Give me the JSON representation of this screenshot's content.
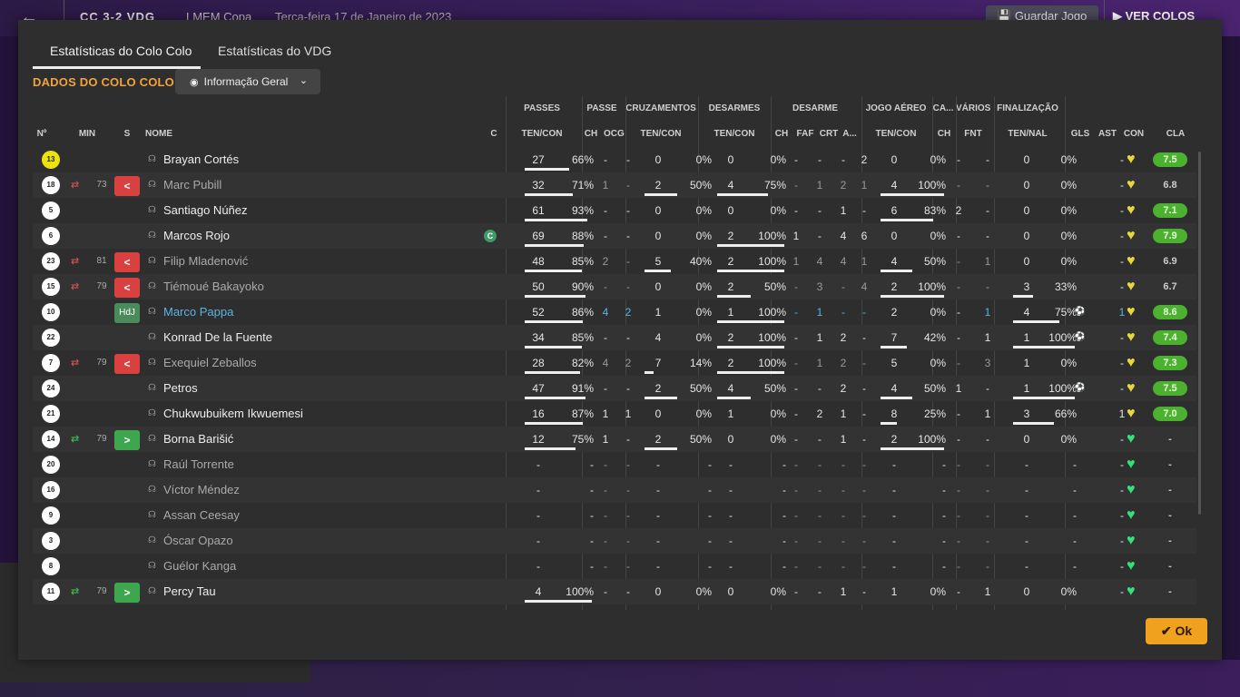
{
  "topbar": {
    "score": "CC 3-2 VDG",
    "competition": "LMEM Copa",
    "date": "Terça-feira 17 de Janeiro de 2023",
    "save_label": "Guardar Jogo",
    "play_label": "VER COLOS"
  },
  "tabs": [
    "Estatísticas do Colo Colo",
    "Estatísticas do VDG"
  ],
  "section_title": "DADOS DO COLO COLO",
  "view_dropdown": "Informação Geral",
  "groups": {
    "passes": "PASSES",
    "passe": "PASSE",
    "cruz": "CRUZAMENTOS",
    "desarmes": "DESARMES",
    "desarme": "DESARME",
    "aereo": "JOGO AÉREO",
    "ca": "CA...",
    "varios": "VÁRIOS",
    "final": "FINALIZAÇÃO"
  },
  "columns": {
    "num": "Nº",
    "min": "MIN",
    "s": "S",
    "name": "NOME",
    "c": "C",
    "passes": "TEN/CON",
    "passe_ch": "CH",
    "passe_ocg": "OCG",
    "cruz": "TEN/CON",
    "desarmes": "TEN/CON",
    "d_ch": "CH",
    "d_faf": "FAF",
    "d_crt": "CRT",
    "d_a": "A...",
    "aereo": "TEN/CON",
    "ca_ch": "CH",
    "fnt": "FNT",
    "final": "TEN/NAL",
    "gls": "GLS",
    "ast": "AST",
    "con": "CON",
    "cla": "CLA"
  },
  "players": [
    {
      "num": "13",
      "gk": true,
      "sub": "",
      "min": "",
      "badge": "",
      "name": "Brayan Cortés",
      "dim": false,
      "blue": false,
      "cap": false,
      "p": [
        "27",
        "66%"
      ],
      "pch": "-",
      "pocg": "-",
      "cr": [
        "0",
        "0%"
      ],
      "ds": [
        "0",
        "0%"
      ],
      "dch": "-",
      "faf": "-",
      "crt": "-",
      "da": "2",
      "ae": [
        "0",
        "0%"
      ],
      "cach": "-",
      "fnt": "-",
      "fi": [
        "0",
        "0%"
      ],
      "gls": "",
      "ast": "-",
      "cla": "7.5",
      "claGreen": true,
      "pf": 0.66,
      "crf": 0,
      "dsf": 0,
      "aef": 0,
      "fif": 0
    },
    {
      "num": "18",
      "gk": false,
      "sub": "out",
      "min": "73",
      "badge": "out",
      "name": "Marc Pubill",
      "dim": true,
      "blue": false,
      "cap": false,
      "p": [
        "32",
        "71%"
      ],
      "pch": "1",
      "pocg": "-",
      "cr": [
        "2",
        "50%"
      ],
      "ds": [
        "4",
        "75%"
      ],
      "dch": "-",
      "faf": "1",
      "crt": "2",
      "da": "1",
      "ae": [
        "4",
        "100%"
      ],
      "cach": "-",
      "fnt": "-",
      "fi": [
        "0",
        "0%"
      ],
      "gls": "",
      "ast": "-",
      "cla": "6.8",
      "claGreen": false,
      "pf": 0.71,
      "crf": 0.5,
      "dsf": 0.75,
      "aef": 1,
      "fif": 0
    },
    {
      "num": "5",
      "gk": false,
      "sub": "",
      "min": "",
      "badge": "",
      "name": "Santiago Núñez",
      "dim": false,
      "blue": false,
      "cap": false,
      "p": [
        "61",
        "93%"
      ],
      "pch": "-",
      "pocg": "-",
      "cr": [
        "0",
        "0%"
      ],
      "ds": [
        "0",
        "0%"
      ],
      "dch": "-",
      "faf": "-",
      "crt": "1",
      "da": "-",
      "ae": [
        "6",
        "83%"
      ],
      "cach": "2",
      "fnt": "-",
      "fi": [
        "0",
        "0%"
      ],
      "gls": "",
      "ast": "-",
      "cla": "7.1",
      "claGreen": true,
      "pf": 0.93,
      "crf": 0,
      "dsf": 0,
      "aef": 0.83,
      "fif": 0
    },
    {
      "num": "6",
      "gk": false,
      "sub": "",
      "min": "",
      "badge": "",
      "name": "Marcos Rojo",
      "dim": false,
      "blue": false,
      "cap": true,
      "p": [
        "69",
        "88%"
      ],
      "pch": "-",
      "pocg": "-",
      "cr": [
        "0",
        "0%"
      ],
      "ds": [
        "2",
        "100%"
      ],
      "dch": "1",
      "faf": "-",
      "crt": "4",
      "da": "6",
      "ae": [
        "0",
        "0%"
      ],
      "cach": "-",
      "fnt": "-",
      "fi": [
        "0",
        "0%"
      ],
      "gls": "",
      "ast": "-",
      "cla": "7.9",
      "claGreen": true,
      "pf": 0.88,
      "crf": 0,
      "dsf": 1,
      "aef": 0,
      "fif": 0
    },
    {
      "num": "23",
      "gk": false,
      "sub": "out",
      "min": "81",
      "badge": "out",
      "name": "Filip Mladenović",
      "dim": true,
      "blue": false,
      "cap": false,
      "p": [
        "48",
        "85%"
      ],
      "pch": "2",
      "pocg": "-",
      "cr": [
        "5",
        "40%"
      ],
      "ds": [
        "2",
        "100%"
      ],
      "dch": "1",
      "faf": "4",
      "crt": "4",
      "da": "1",
      "ae": [
        "4",
        "50%"
      ],
      "cach": "-",
      "fnt": "1",
      "fi": [
        "0",
        "0%"
      ],
      "gls": "",
      "ast": "-",
      "cla": "6.9",
      "claGreen": false,
      "pf": 0.85,
      "crf": 0.4,
      "dsf": 1,
      "aef": 0.5,
      "fif": 0
    },
    {
      "num": "15",
      "gk": false,
      "sub": "out",
      "min": "79",
      "badge": "out",
      "name": "Tiémoué Bakayoko",
      "dim": true,
      "blue": false,
      "cap": false,
      "p": [
        "50",
        "90%"
      ],
      "pch": "-",
      "pocg": "-",
      "cr": [
        "0",
        "0%"
      ],
      "ds": [
        "2",
        "50%"
      ],
      "dch": "-",
      "faf": "3",
      "crt": "-",
      "da": "4",
      "ae": [
        "2",
        "100%"
      ],
      "cach": "-",
      "fnt": "-",
      "fi": [
        "3",
        "33%"
      ],
      "gls": "",
      "ast": "-",
      "cla": "6.7",
      "claGreen": false,
      "pf": 0.9,
      "crf": 0,
      "dsf": 0.5,
      "aef": 1,
      "fif": 0.33
    },
    {
      "num": "10",
      "gk": false,
      "sub": "",
      "min": "",
      "badge": "hdj",
      "name": "Marco Pappa",
      "dim": false,
      "blue": true,
      "cap": false,
      "p": [
        "52",
        "86%"
      ],
      "pch": "4",
      "pocg": "2",
      "cr": [
        "1",
        "0%"
      ],
      "ds": [
        "1",
        "100%"
      ],
      "dch": "-",
      "faf": "1",
      "crt": "-",
      "da": "-",
      "ae": [
        "2",
        "0%"
      ],
      "cach": "-",
      "fnt": "1",
      "fi": [
        "4",
        "75%"
      ],
      "gls": "⚽",
      "ast": "1",
      "cla": "8.6",
      "claGreen": true,
      "pf": 0.86,
      "crf": 0,
      "dsf": 1,
      "aef": 0,
      "fif": 0.75
    },
    {
      "num": "22",
      "gk": false,
      "sub": "",
      "min": "",
      "badge": "",
      "name": "Konrad De la Fuente",
      "dim": false,
      "blue": false,
      "cap": false,
      "p": [
        "34",
        "85%"
      ],
      "pch": "-",
      "pocg": "-",
      "cr": [
        "4",
        "0%"
      ],
      "ds": [
        "2",
        "100%"
      ],
      "dch": "-",
      "faf": "1",
      "crt": "2",
      "da": "-",
      "ae": [
        "7",
        "42%"
      ],
      "cach": "-",
      "fnt": "1",
      "fi": [
        "1",
        "100%"
      ],
      "gls": "⚽",
      "ast": "-",
      "cla": "7.4",
      "claGreen": true,
      "pf": 0.85,
      "crf": 0,
      "dsf": 1,
      "aef": 0.42,
      "fif": 1
    },
    {
      "num": "7",
      "gk": false,
      "sub": "out",
      "min": "79",
      "badge": "out",
      "name": "Exequiel Zeballos",
      "dim": true,
      "blue": false,
      "cap": false,
      "p": [
        "28",
        "82%"
      ],
      "pch": "4",
      "pocg": "2",
      "cr": [
        "7",
        "14%"
      ],
      "ds": [
        "2",
        "100%"
      ],
      "dch": "-",
      "faf": "1",
      "crt": "2",
      "da": "-",
      "ae": [
        "5",
        "0%"
      ],
      "cach": "-",
      "fnt": "3",
      "fi": [
        "1",
        "0%"
      ],
      "gls": "",
      "ast": "-",
      "cla": "7.3",
      "claGreen": true,
      "pf": 0.82,
      "crf": 0.14,
      "dsf": 1,
      "aef": 0,
      "fif": 0
    },
    {
      "num": "24",
      "gk": false,
      "sub": "",
      "min": "",
      "badge": "",
      "name": "Petros",
      "dim": false,
      "blue": false,
      "cap": false,
      "p": [
        "47",
        "91%"
      ],
      "pch": "-",
      "pocg": "-",
      "cr": [
        "2",
        "50%"
      ],
      "ds": [
        "4",
        "50%"
      ],
      "dch": "-",
      "faf": "-",
      "crt": "2",
      "da": "-",
      "ae": [
        "4",
        "50%"
      ],
      "cach": "1",
      "fnt": "-",
      "fi": [
        "1",
        "100%"
      ],
      "gls": "⚽",
      "ast": "-",
      "cla": "7.5",
      "claGreen": true,
      "pf": 0.91,
      "crf": 0.5,
      "dsf": 0.5,
      "aef": 0.5,
      "fif": 1
    },
    {
      "num": "21",
      "gk": false,
      "sub": "",
      "min": "",
      "badge": "",
      "name": "Chukwubuikem Ikwuemesi",
      "dim": false,
      "blue": false,
      "cap": false,
      "p": [
        "16",
        "87%"
      ],
      "pch": "1",
      "pocg": "1",
      "cr": [
        "0",
        "0%"
      ],
      "ds": [
        "1",
        "0%"
      ],
      "dch": "-",
      "faf": "2",
      "crt": "1",
      "da": "-",
      "ae": [
        "8",
        "25%"
      ],
      "cach": "-",
      "fnt": "1",
      "fi": [
        "3",
        "66%"
      ],
      "gls": "",
      "ast": "1",
      "cla": "7.0",
      "claGreen": true,
      "pf": 0.87,
      "crf": 0,
      "dsf": 0,
      "aef": 0.25,
      "fif": 0.66
    },
    {
      "num": "14",
      "gk": false,
      "sub": "in",
      "min": "79",
      "badge": "in",
      "name": "Borna Barišić",
      "dim": false,
      "blue": false,
      "cap": false,
      "p": [
        "12",
        "75%"
      ],
      "pch": "1",
      "pocg": "-",
      "cr": [
        "2",
        "50%"
      ],
      "ds": [
        "0",
        "0%"
      ],
      "dch": "-",
      "faf": "-",
      "crt": "1",
      "da": "-",
      "ae": [
        "2",
        "100%"
      ],
      "cach": "-",
      "fnt": "-",
      "fi": [
        "0",
        "0%"
      ],
      "gls": "",
      "ast": "-",
      "cla": "-",
      "claGreen": false,
      "pf": 0.75,
      "crf": 0.5,
      "dsf": 0,
      "aef": 1,
      "fif": 0
    },
    {
      "num": "20",
      "gk": false,
      "sub": "",
      "min": "",
      "badge": "",
      "name": "Raúl Torrente",
      "dim": true,
      "blue": false,
      "cap": false,
      "p": [
        "-",
        "-"
      ],
      "pch": "-",
      "pocg": "-",
      "cr": [
        "-",
        "-"
      ],
      "ds": [
        "-",
        "-"
      ],
      "dch": "-",
      "faf": "-",
      "crt": "-",
      "da": "-",
      "ae": [
        "-",
        "-"
      ],
      "cach": "-",
      "fnt": "-",
      "fi": [
        "-",
        "-"
      ],
      "gls": "",
      "ast": "-",
      "cla": "-",
      "claGreen": false,
      "pf": 0,
      "crf": 0,
      "dsf": 0,
      "aef": 0,
      "fif": 0
    },
    {
      "num": "16",
      "gk": false,
      "sub": "",
      "min": "",
      "badge": "",
      "name": "Víctor Méndez",
      "dim": true,
      "blue": false,
      "cap": false,
      "p": [
        "-",
        "-"
      ],
      "pch": "-",
      "pocg": "-",
      "cr": [
        "-",
        "-"
      ],
      "ds": [
        "-",
        "-"
      ],
      "dch": "-",
      "faf": "-",
      "crt": "-",
      "da": "-",
      "ae": [
        "-",
        "-"
      ],
      "cach": "-",
      "fnt": "-",
      "fi": [
        "-",
        "-"
      ],
      "gls": "",
      "ast": "-",
      "cla": "-",
      "claGreen": false,
      "pf": 0,
      "crf": 0,
      "dsf": 0,
      "aef": 0,
      "fif": 0
    },
    {
      "num": "9",
      "gk": false,
      "sub": "",
      "min": "",
      "badge": "",
      "name": "Assan Ceesay",
      "dim": true,
      "blue": false,
      "cap": false,
      "p": [
        "-",
        "-"
      ],
      "pch": "-",
      "pocg": "-",
      "cr": [
        "-",
        "-"
      ],
      "ds": [
        "-",
        "-"
      ],
      "dch": "-",
      "faf": "-",
      "crt": "-",
      "da": "-",
      "ae": [
        "-",
        "-"
      ],
      "cach": "-",
      "fnt": "-",
      "fi": [
        "-",
        "-"
      ],
      "gls": "",
      "ast": "-",
      "cla": "-",
      "claGreen": false,
      "pf": 0,
      "crf": 0,
      "dsf": 0,
      "aef": 0,
      "fif": 0
    },
    {
      "num": "3",
      "gk": false,
      "sub": "",
      "min": "",
      "badge": "",
      "name": "Óscar Opazo",
      "dim": true,
      "blue": false,
      "cap": false,
      "p": [
        "-",
        "-"
      ],
      "pch": "-",
      "pocg": "-",
      "cr": [
        "-",
        "-"
      ],
      "ds": [
        "-",
        "-"
      ],
      "dch": "-",
      "faf": "-",
      "crt": "-",
      "da": "-",
      "ae": [
        "-",
        "-"
      ],
      "cach": "-",
      "fnt": "-",
      "fi": [
        "-",
        "-"
      ],
      "gls": "",
      "ast": "-",
      "cla": "-",
      "claGreen": false,
      "pf": 0,
      "crf": 0,
      "dsf": 0,
      "aef": 0,
      "fif": 0
    },
    {
      "num": "8",
      "gk": false,
      "sub": "",
      "min": "",
      "badge": "",
      "name": "Guélor Kanga",
      "dim": true,
      "blue": false,
      "cap": false,
      "p": [
        "-",
        "-"
      ],
      "pch": "-",
      "pocg": "-",
      "cr": [
        "-",
        "-"
      ],
      "ds": [
        "-",
        "-"
      ],
      "dch": "-",
      "faf": "-",
      "crt": "-",
      "da": "-",
      "ae": [
        "-",
        "-"
      ],
      "cach": "-",
      "fnt": "-",
      "fi": [
        "-",
        "-"
      ],
      "gls": "",
      "ast": "-",
      "cla": "-",
      "claGreen": false,
      "pf": 0,
      "crf": 0,
      "dsf": 0,
      "aef": 0,
      "fif": 0
    },
    {
      "num": "11",
      "gk": false,
      "sub": "in",
      "min": "79",
      "badge": "in",
      "name": "Percy Tau",
      "dim": false,
      "blue": false,
      "cap": false,
      "p": [
        "4",
        "100%"
      ],
      "pch": "-",
      "pocg": "-",
      "cr": [
        "0",
        "0%"
      ],
      "ds": [
        "0",
        "0%"
      ],
      "dch": "-",
      "faf": "-",
      "crt": "1",
      "da": "-",
      "ae": [
        "1",
        "0%"
      ],
      "cach": "-",
      "fnt": "1",
      "fi": [
        "0",
        "0%"
      ],
      "gls": "",
      "ast": "-",
      "cla": "-",
      "claGreen": false,
      "pf": 1,
      "crf": 0,
      "dsf": 0,
      "aef": 0,
      "fif": 0
    }
  ],
  "ok_label": "Ok",
  "colors": {
    "accent": "#f2a33b",
    "ok": "#f0a21e",
    "rating_green": "#4cb030",
    "sub_out": "#d94040",
    "sub_in": "#3ea64f",
    "heart_green": "#33e07a",
    "heart_yellow": "#e6d83a"
  }
}
